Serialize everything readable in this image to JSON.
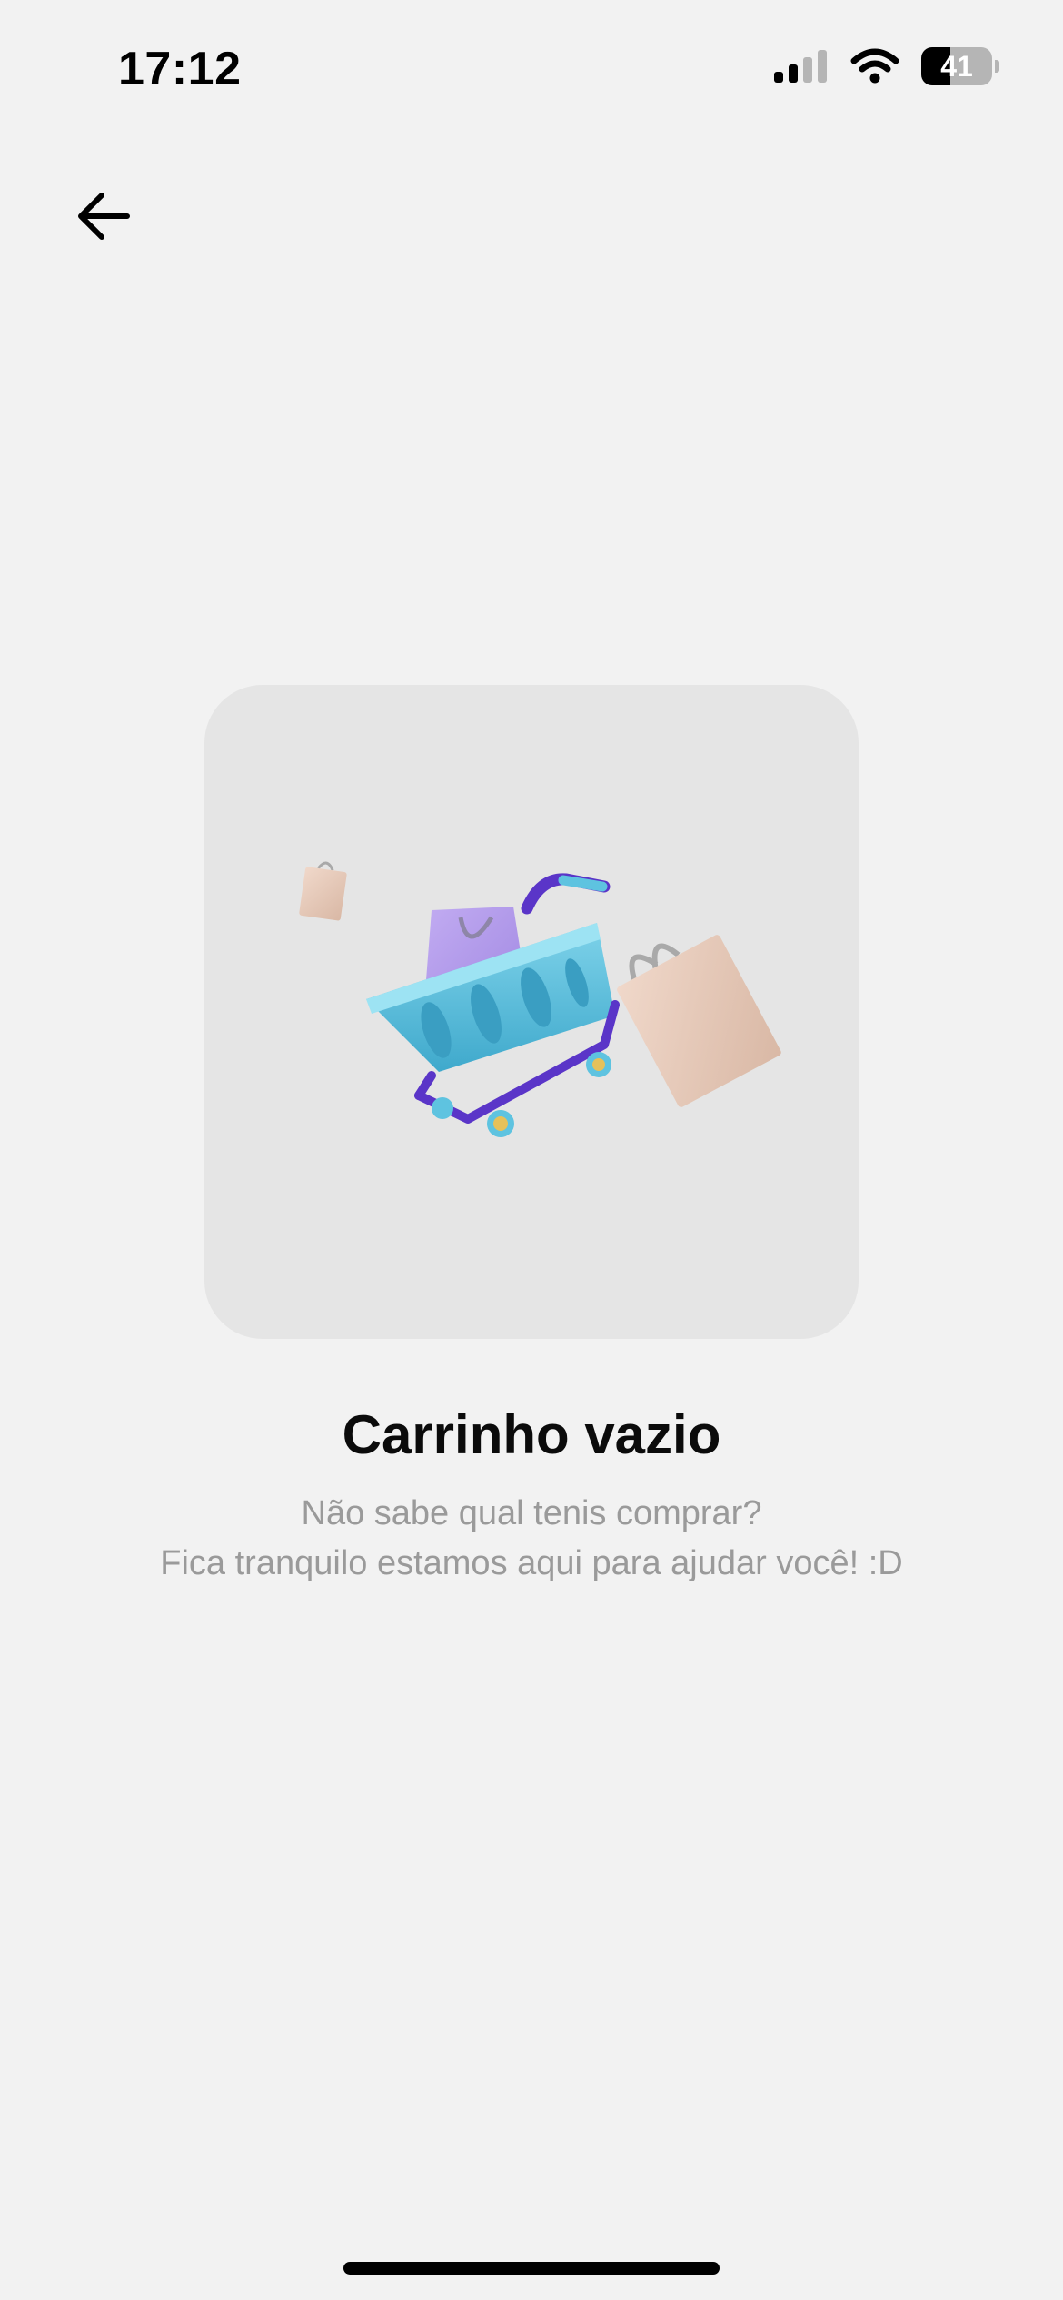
{
  "status_bar": {
    "time": "17:12",
    "battery_level": "41",
    "battery_fraction": 0.41,
    "icons": [
      "cellular-signal-icon",
      "wifi-icon",
      "battery-icon"
    ]
  },
  "nav": {
    "back_icon": "arrow-left-icon"
  },
  "empty_state": {
    "illustration": "shopping-cart-with-bags",
    "title": "Carrinho vazio",
    "subtitle_line1": "Não sabe qual tenis comprar?",
    "subtitle_line2": "Fica tranquilo estamos aqui para ajudar você! :D"
  },
  "colors": {
    "background": "#f2f2f2",
    "card": "#e5e5e5",
    "cart_basket": "#5ec3e0",
    "cart_frame": "#5a35c8",
    "bag_purple": "#b49cec",
    "bag_beige": "#e7c9b8",
    "subtitle": "#9a9a9a"
  }
}
